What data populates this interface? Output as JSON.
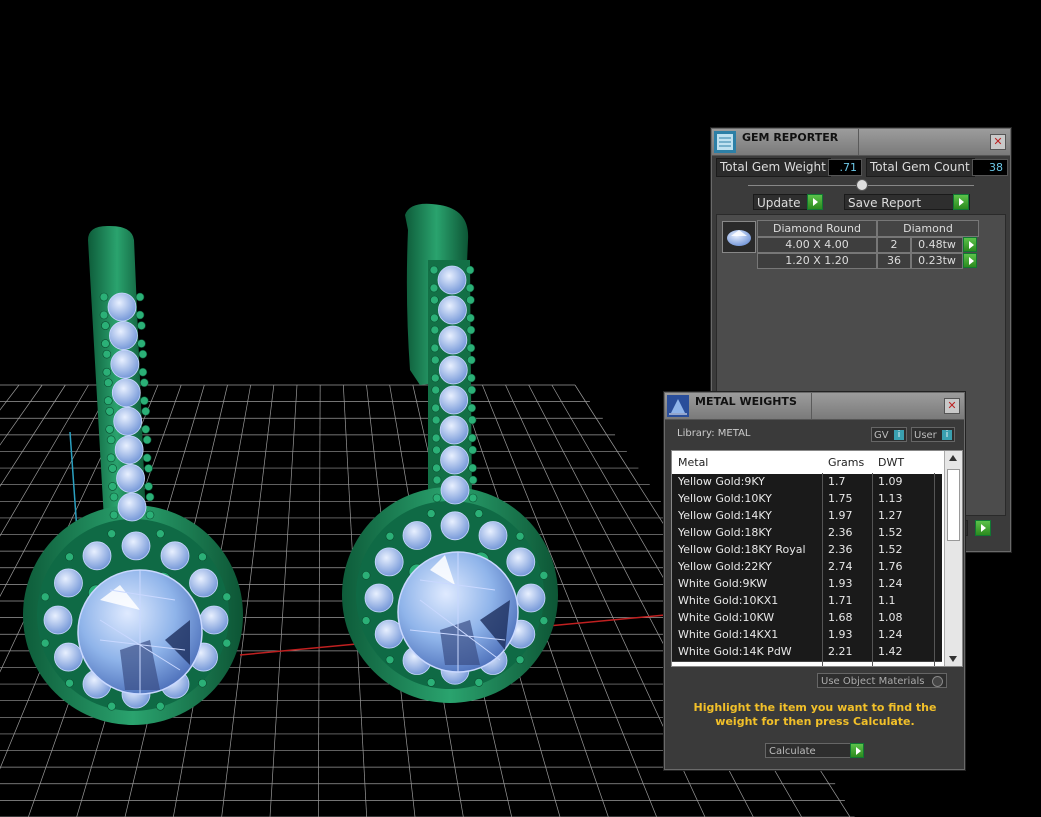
{
  "gem_reporter": {
    "title": "GEM REPORTER",
    "total_weight_label": "Total Gem Weight",
    "total_weight_value": ".71",
    "total_count_label": "Total Gem Count",
    "total_count_value": "38",
    "update_label": "Update",
    "save_report_label": "Save Report",
    "table": {
      "headers": [
        "Diamond Round",
        "Diamond"
      ],
      "rows": [
        {
          "size": "4.00 X 4.00",
          "count": "2",
          "weight": "0.48tw"
        },
        {
          "size": "1.20 X 1.20",
          "count": "36",
          "weight": "0.23tw"
        }
      ]
    }
  },
  "metal_weights": {
    "title": "METAL WEIGHTS",
    "library_label": "Library: METAL",
    "gv_label": "GV",
    "user_label": "User",
    "columns": [
      "Metal",
      "Grams",
      "DWT"
    ],
    "rows": [
      {
        "metal": "Yellow Gold:9KY",
        "grams": "1.7",
        "dwt": "1.09"
      },
      {
        "metal": "Yellow Gold:10KY",
        "grams": "1.75",
        "dwt": "1.13"
      },
      {
        "metal": "Yellow Gold:14KY",
        "grams": "1.97",
        "dwt": "1.27"
      },
      {
        "metal": "Yellow Gold:18KY",
        "grams": "2.36",
        "dwt": "1.52"
      },
      {
        "metal": "Yellow Gold:18KY Royal",
        "grams": "2.36",
        "dwt": "1.52"
      },
      {
        "metal": "Yellow Gold:22KY",
        "grams": "2.74",
        "dwt": "1.76"
      },
      {
        "metal": "White Gold:9KW",
        "grams": "1.93",
        "dwt": "1.24"
      },
      {
        "metal": "White Gold:10KX1",
        "grams": "1.71",
        "dwt": "1.1"
      },
      {
        "metal": "White Gold:10KW",
        "grams": "1.68",
        "dwt": "1.08"
      },
      {
        "metal": "White Gold:14KX1",
        "grams": "1.93",
        "dwt": "1.24"
      },
      {
        "metal": "White Gold:14K PdW",
        "grams": "2.21",
        "dwt": "1.42"
      }
    ],
    "use_object_materials_label": "Use Object Materials",
    "hint_text": "Highlight the item you want to find the weight for then press Calculate.",
    "calculate_label": "Calculate"
  },
  "colors": {
    "metal": "#1f8a5c",
    "gem": "#8fb4ea",
    "grid": "#9a9a9a",
    "hint": "#f2c029"
  }
}
